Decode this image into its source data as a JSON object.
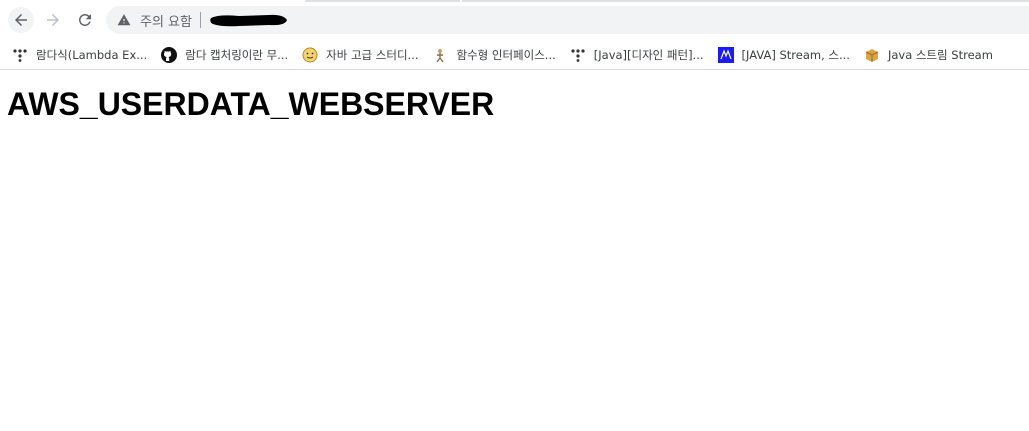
{
  "browser": {
    "nav": {
      "back": "back-arrow-icon",
      "forward": "forward-arrow-icon",
      "reload": "reload-icon"
    },
    "address_bar": {
      "security_label": "주의 요함",
      "security_icon": "warning-icon",
      "url_redacted": true
    },
    "bookmarks": [
      {
        "label": "람다식(Lambda Ex...",
        "icon": "tistory-icon"
      },
      {
        "label": "람다 캡처링이란 무...",
        "icon": "github-icon"
      },
      {
        "label": "자바 고급 스터디...",
        "icon": "smiley-icon"
      },
      {
        "label": "함수형 인터페이스...",
        "icon": "figure-icon"
      },
      {
        "label": "[Java][디자인 패턴]...",
        "icon": "tistory-icon"
      },
      {
        "label": "[JAVA] Stream, 스...",
        "icon": "blue-logo-icon"
      },
      {
        "label": "Java 스트림 Stream",
        "icon": "box-icon"
      }
    ]
  },
  "page": {
    "heading": "AWS_USERDATA_WEBSERVER"
  },
  "colors": {
    "toolbar_bg": "#ffffff",
    "omnibox_bg": "#f1f3f4",
    "text_muted": "#5f6368"
  }
}
